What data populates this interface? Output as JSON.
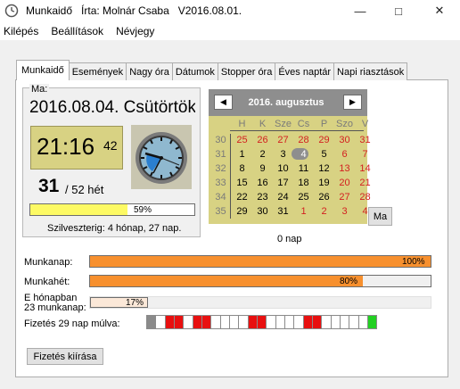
{
  "window": {
    "title": "Munkaidő   Írta: Molnár Csaba   V2016.08.01.",
    "controls": [
      "—",
      "□",
      "✕"
    ]
  },
  "menu": [
    "Kilépés",
    "Beállítások",
    "Névjegy"
  ],
  "tabs": [
    "Munkaidő",
    "Események",
    "Nagy óra",
    "Dátumok",
    "Stopper óra",
    "Éves naptár",
    "Napi riasztások"
  ],
  "today": {
    "label": "Ma:",
    "date": "2016.08.04. Csütörtök",
    "time": "21:16",
    "seconds": "42",
    "week": "31",
    "week_suffix": "/ 52 hét",
    "year_progress": 59,
    "year_progress_text": "59%",
    "new_year_text": "Szilveszterig: 4 hónap, 27 nap."
  },
  "calendar": {
    "title": "2016. augusztus",
    "prev": "◀",
    "next": "▶",
    "weekdays": [
      "H",
      "K",
      "Sze",
      "Cs",
      "P",
      "Szo",
      "V"
    ],
    "weeks": [
      "30",
      "31",
      "32",
      "33",
      "34",
      "35"
    ],
    "days": [
      [
        "25",
        "26",
        "27",
        "28",
        "29",
        "30",
        "31"
      ],
      [
        "1",
        "2",
        "3",
        "4",
        "5",
        "6",
        "7"
      ],
      [
        "8",
        "9",
        "10",
        "11",
        "12",
        "13",
        "14"
      ],
      [
        "15",
        "16",
        "17",
        "18",
        "19",
        "20",
        "21"
      ],
      [
        "22",
        "23",
        "24",
        "25",
        "26",
        "27",
        "28"
      ],
      [
        "29",
        "30",
        "31",
        "1",
        "2",
        "3",
        "4"
      ]
    ],
    "today_button": "Ma",
    "days_text": "0 nap",
    "colors": {
      "other_month": "#d32020",
      "weekend": "#d32020",
      "weeknum": "#7a7a7a",
      "background": "#d8d283"
    }
  },
  "stats": {
    "workday": {
      "label": "Munkanap:",
      "value": 100,
      "text": "100%"
    },
    "workweek": {
      "label": "Munkahét:",
      "value": 80,
      "text": "80%"
    },
    "month": {
      "label_line1": "E hónapban",
      "label_line2": "23 munkanap:",
      "value": 17,
      "text": "17%"
    },
    "payday": {
      "label": "Fizetés 29 nap múlva:"
    },
    "pay_button": "Fizetés kiírása"
  },
  "pay_segments": [
    "g",
    "w",
    "r",
    "r",
    "w",
    "r",
    "r",
    "w",
    "w",
    "w",
    "w",
    "r",
    "r",
    "w",
    "w",
    "w",
    "w",
    "r",
    "r",
    "w",
    "w",
    "w",
    "w",
    "w",
    "g2"
  ],
  "accent": {
    "orange": "#f7902e",
    "yellow": "#fdfa64",
    "red": "#e81010",
    "green": "#22d022",
    "gray": "#8a8a8a"
  }
}
